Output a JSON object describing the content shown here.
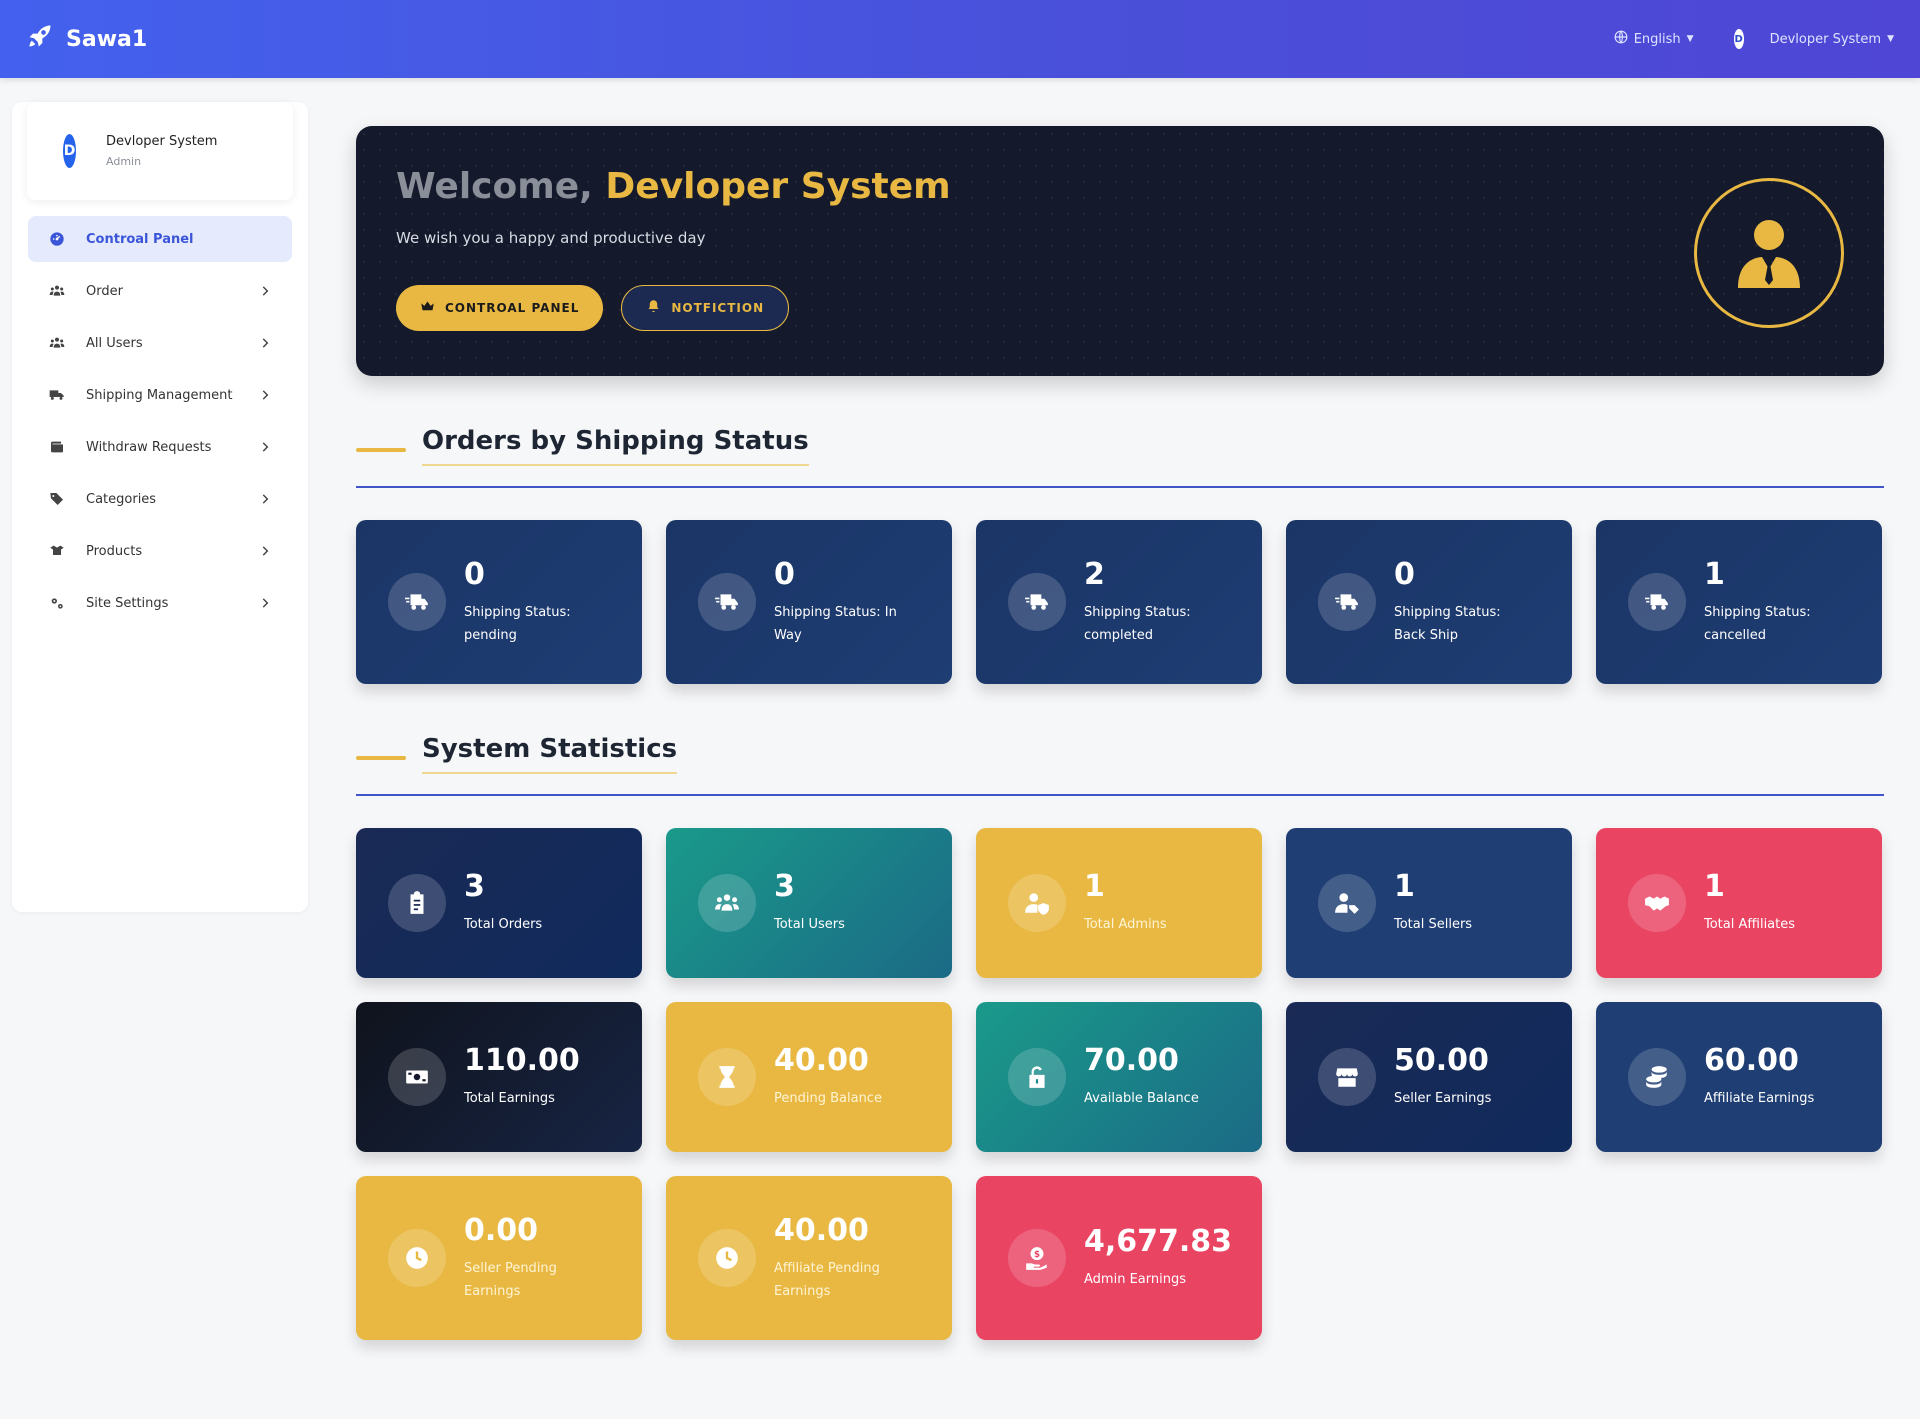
{
  "topbar": {
    "brand": "Sawa1",
    "language": "English",
    "user_initial": "D",
    "user_name": "Devloper System"
  },
  "sidebar": {
    "profile": {
      "initial": "D",
      "name": "Devloper System",
      "role": "Admin"
    },
    "items": [
      {
        "label": "Controal Panel",
        "icon": "dashboard-icon",
        "active": true
      },
      {
        "label": "Order",
        "icon": "users-icon"
      },
      {
        "label": "All Users",
        "icon": "users-icon"
      },
      {
        "label": "Shipping Management",
        "icon": "truck-icon"
      },
      {
        "label": "Withdraw Requests",
        "icon": "wallet-icon"
      },
      {
        "label": "Categories",
        "icon": "tags-icon"
      },
      {
        "label": "Products",
        "icon": "box-icon"
      },
      {
        "label": "Site Settings",
        "icon": "gears-icon"
      }
    ]
  },
  "hero": {
    "welcome": "Welcome,",
    "name": "Devloper System",
    "subtitle": "We wish you a happy and productive day",
    "btn_panel": "CONTROAL PANEL",
    "btn_notif": "NOTFICTION"
  },
  "shipping": {
    "title": "Orders by Shipping Status",
    "cards": [
      {
        "value": "0",
        "label": "Shipping Status: pending"
      },
      {
        "value": "0",
        "label": "Shipping Status: In Way"
      },
      {
        "value": "2",
        "label": "Shipping Status: completed"
      },
      {
        "value": "0",
        "label": "Shipping Status: Back Ship"
      },
      {
        "value": "1",
        "label": "Shipping Status: cancelled"
      }
    ]
  },
  "stats": {
    "title": "System Statistics",
    "cards": [
      {
        "value": "3",
        "label": "Total Orders"
      },
      {
        "value": "3",
        "label": "Total Users"
      },
      {
        "value": "1",
        "label": "Total Admins"
      },
      {
        "value": "1",
        "label": "Total Sellers"
      },
      {
        "value": "1",
        "label": "Total Affiliates"
      },
      {
        "value": "110.00",
        "label": "Total Earnings"
      },
      {
        "value": "40.00",
        "label": "Pending Balance"
      },
      {
        "value": "70.00",
        "label": "Available Balance"
      },
      {
        "value": "50.00",
        "label": "Seller Earnings"
      },
      {
        "value": "60.00",
        "label": "Affiliate Earnings"
      },
      {
        "value": "0.00",
        "label": "Seller Pending Earnings"
      },
      {
        "value": "40.00",
        "label": "Affiliate Pending Earnings"
      },
      {
        "value": "4,677.83",
        "label": "Admin Earnings"
      }
    ]
  },
  "colors": {
    "primary": "#4361ee",
    "gold": "#e8b843",
    "navy": "#1e3d73",
    "teal": "#1a9a8a",
    "red": "#ea4463"
  }
}
